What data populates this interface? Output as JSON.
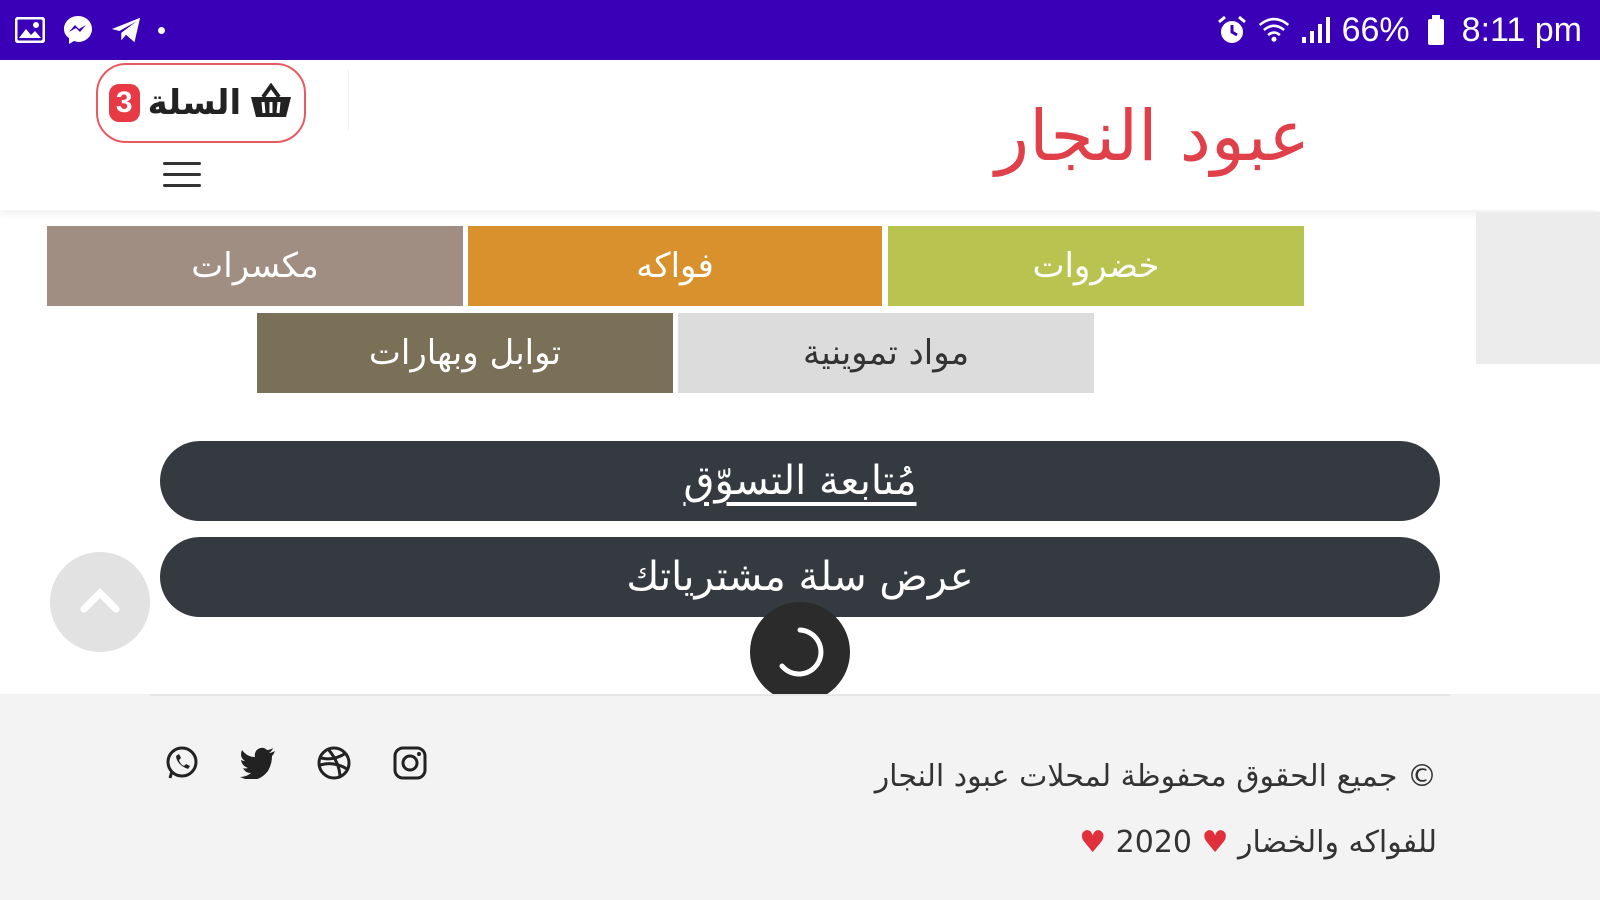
{
  "status_bar": {
    "battery": "66%",
    "time": "8:11 pm",
    "left_icons": [
      "gallery-icon",
      "messenger-icon",
      "telegram-icon"
    ],
    "right_icons": [
      "alarm-icon",
      "wifi-icon",
      "signal-icon",
      "battery-icon"
    ]
  },
  "header": {
    "brand": "عبود النجار",
    "cart_label": "السلة",
    "cart_count": "3",
    "cart_icon": "basket-icon",
    "menu_icon": "hamburger-menu-icon"
  },
  "categories": [
    {
      "label": "خضروات",
      "color": "#b8c44f"
    },
    {
      "label": "فواكه",
      "color": "#d8912c"
    },
    {
      "label": "مكسرات",
      "color": "#a08e83"
    },
    {
      "label": "مواد تموينية",
      "color": "#dcdcdc"
    },
    {
      "label": "توابل وبهارات",
      "color": "#7a6f57"
    }
  ],
  "actions": {
    "continue_shopping": "مُتابعة التسوّق",
    "view_cart": "عرض سلة مشترياتك"
  },
  "footer": {
    "copyright_line1": "© جميع الحقوق محفوظة لمحلات عبود النجار",
    "copyright_line2_prefix": "للفواكه والخضار",
    "year": "2020",
    "heart": "♥",
    "socials": [
      "instagram-icon",
      "dribbble-icon",
      "twitter-icon",
      "whatsapp-icon"
    ]
  },
  "colors": {
    "status_bar": "#3a00b8",
    "brand": "#e0404a",
    "cart_border": "#e85a62",
    "badge": "#e83a44",
    "pill": "#343a40"
  }
}
